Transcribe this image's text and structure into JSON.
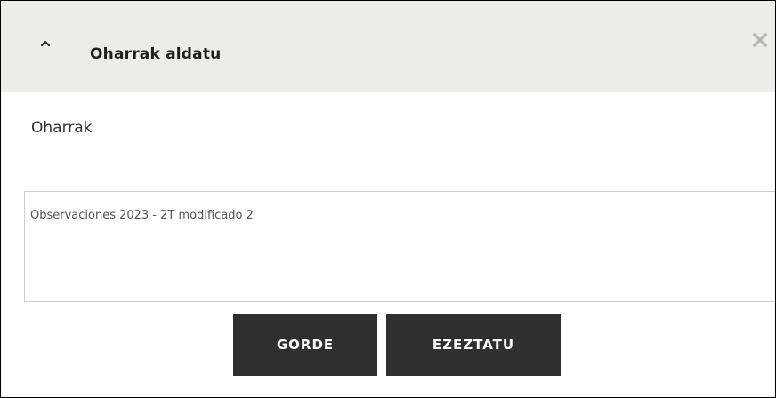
{
  "dialog": {
    "title": "Oharrak aldatu",
    "collapse_icon": "chevron-up-icon",
    "close_icon": "close-icon"
  },
  "form": {
    "notes_label": "Oharrak",
    "notes_value": "Observaciones 2023 - 2T modificado 2"
  },
  "actions": {
    "save_label": "GORDE",
    "cancel_label": "EZEZTATU"
  },
  "colors": {
    "header_bg": "#ecece8",
    "button_bg": "#2f2f2f",
    "button_text": "#ffffff",
    "close_icon": "#b5b5b5"
  }
}
